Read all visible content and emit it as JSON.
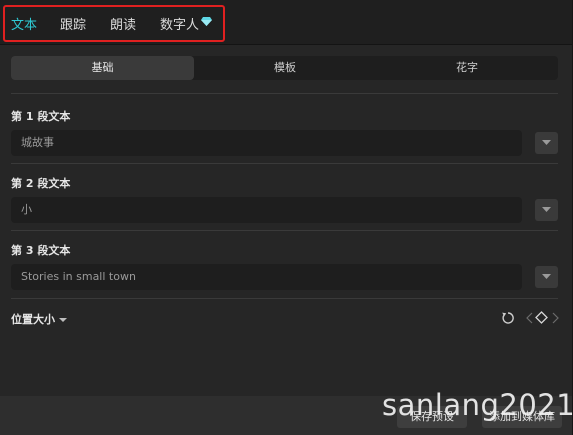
{
  "tabs": [
    {
      "label": "文本",
      "active": true
    },
    {
      "label": "跟踪",
      "active": false
    },
    {
      "label": "朗读",
      "active": false
    },
    {
      "label": "数字人",
      "active": false,
      "icon": "diamond-icon"
    }
  ],
  "segments": [
    {
      "label": "基础",
      "active": true
    },
    {
      "label": "模板",
      "active": false
    },
    {
      "label": "花字",
      "active": false
    }
  ],
  "text_fields": [
    {
      "label": "第 1 段文本",
      "value": "城故事"
    },
    {
      "label": "第 2 段文本",
      "value": "小"
    },
    {
      "label": "第 3 段文本",
      "value": "Stories in small town"
    }
  ],
  "section": {
    "label": "位置大小"
  },
  "footer": {
    "save_preset": "保存预设",
    "add_to_library": "添加到媒体库"
  },
  "watermark": "sanlang2021",
  "colors": {
    "accent": "#2ec9d3",
    "gem": "#5fd8e6",
    "highlight_border": "#e02020"
  }
}
